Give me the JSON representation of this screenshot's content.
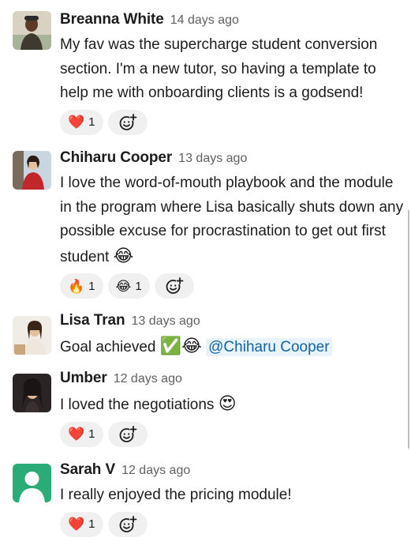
{
  "messages": [
    {
      "author": "Breanna White",
      "time": "14 days ago",
      "text": "My fav was the supercharge student conversion section. I'm a new tutor, so having a template to help me with onboarding clients is a godsend!",
      "reactions": [
        {
          "emoji": "❤️",
          "count": "1"
        }
      ]
    },
    {
      "author": "Chiharu Cooper",
      "time": "13 days ago",
      "text": "I love the word-of-mouth playbook and the module in the program where Lisa basically shuts down any possible excuse for procrastination to get out first student",
      "trailing_emoji": "😂",
      "reactions": [
        {
          "emoji": "🔥",
          "count": "1"
        },
        {
          "emoji": "😂",
          "count": "1"
        }
      ]
    },
    {
      "author": "Lisa Tran",
      "time": "13 days ago",
      "text": "Goal achieved",
      "trailing_emoji": "✅😂",
      "mention": "@Chiharu Cooper"
    },
    {
      "author": "Umber",
      "time": "12 days ago",
      "text": "I loved the negotiations",
      "trailing_emoji": "😍",
      "reactions": [
        {
          "emoji": "❤️",
          "count": "1"
        }
      ]
    },
    {
      "author": "Sarah V",
      "time": "12 days ago",
      "text": "I really enjoyed the pricing module!",
      "reactions": [
        {
          "emoji": "❤️",
          "count": "1"
        }
      ]
    }
  ],
  "add_reaction_icon": "add-reaction-icon",
  "colors": {
    "link": "#1264a3",
    "mention_bg": "#e8f3fb",
    "pill_bg": "#f0f0f0",
    "muted": "#616061",
    "default_avatar": "#2bac76"
  }
}
